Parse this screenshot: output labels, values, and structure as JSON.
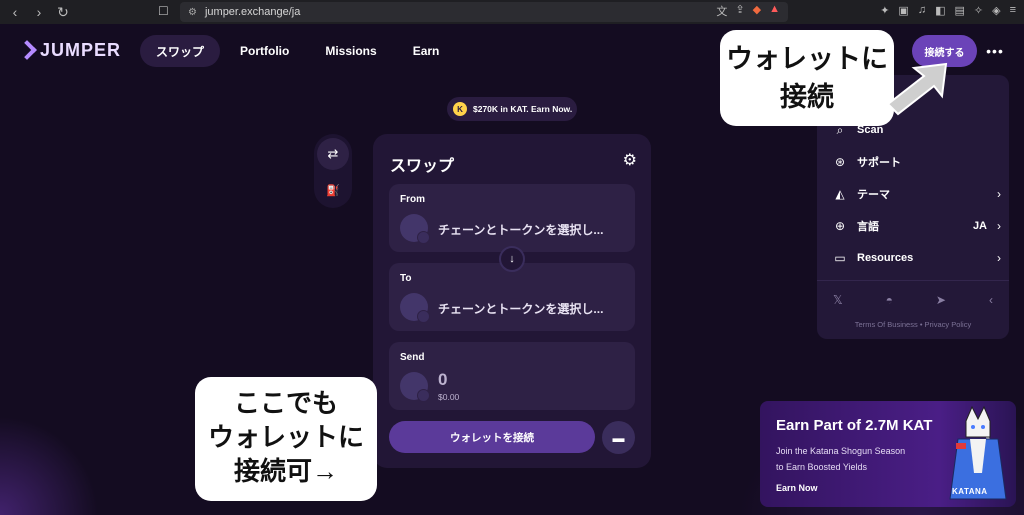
{
  "browser": {
    "url": "jumper.exchange/ja",
    "nav_icons": [
      "back-icon",
      "forward-icon",
      "reload-icon"
    ]
  },
  "app": {
    "logo": "JUMPER",
    "tabs": [
      {
        "label": "スワップ",
        "active": true
      },
      {
        "label": "Portfolio",
        "active": false
      },
      {
        "label": "Missions",
        "active": false
      },
      {
        "label": "Earn",
        "active": false
      }
    ],
    "connect_button": "接続する",
    "promo_pill": "$270K in KAT. Earn Now."
  },
  "swap": {
    "title": "スワップ",
    "from_label": "From",
    "from_select": "チェーンとトークンを選択し...",
    "to_label": "To",
    "to_select": "チェーンとトークンを選択し...",
    "send_label": "Send",
    "send_amount": "0",
    "send_usd": "$0.00",
    "wallet_button": "ウォレットを接続"
  },
  "menu": {
    "items": [
      {
        "icon": "search-icon",
        "label": "Scan"
      },
      {
        "icon": "support-icon",
        "label": "サポート"
      },
      {
        "icon": "theme-icon",
        "label": "テーマ"
      },
      {
        "icon": "globe-icon",
        "label": "言語",
        "value": "JA"
      },
      {
        "icon": "folder-icon",
        "label": "Resources"
      }
    ],
    "legal": "Terms Of Business • Privacy Policy"
  },
  "callouts": {
    "top_line1": "ウォレットに",
    "top_line2": "接続",
    "bottom_line1": "ここでも",
    "bottom_line2": "ウォレットに",
    "bottom_line3": "接続可→"
  },
  "banner": {
    "title": "Earn Part of 2.7M KAT",
    "subtitle_line1": "Join the Katana Shogun Season",
    "subtitle_line2": "to Earn Boosted Yields",
    "cta": "Earn Now",
    "brand": "KATANA"
  },
  "colors": {
    "background": "#140c21",
    "accent": "#6b43b8",
    "card": "#221636"
  }
}
